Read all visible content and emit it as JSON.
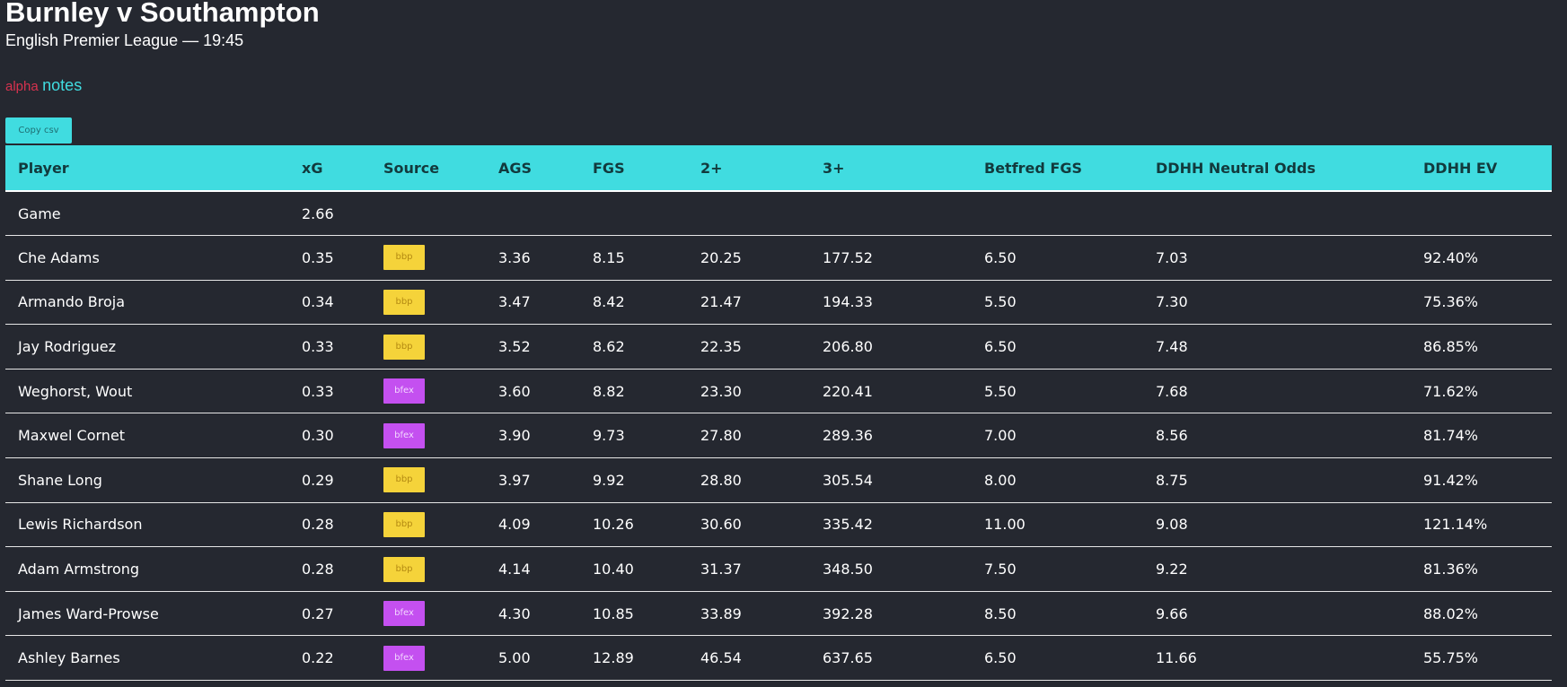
{
  "header": {
    "title": "Burnley v Southampton",
    "subtitle": "English Premier League — 19:45"
  },
  "brand": {
    "alpha": "alpha",
    "notes": "notes"
  },
  "toolbar": {
    "copy_csv_label": "Copy csv"
  },
  "colors": {
    "background": "#252830",
    "accent_cyan": "#40dce0",
    "brand_red": "#d8324f",
    "badge_bbp": "#f5d33a",
    "badge_bfex": "#c450f0"
  },
  "table": {
    "columns": [
      "Player",
      "xG",
      "Source",
      "AGS",
      "FGS",
      "2+",
      "3+",
      "Betfred FGS",
      "DDHH Neutral Odds",
      "DDHH EV"
    ],
    "rows": [
      {
        "player": "Game",
        "xg": "2.66",
        "source": "",
        "ags": "",
        "fgs": "",
        "two_plus": "",
        "three_plus": "",
        "betfred_fgs": "",
        "ddhh_odds": "",
        "ddhh_ev": ""
      },
      {
        "player": "Che Adams",
        "xg": "0.35",
        "source": "bbp",
        "ags": "3.36",
        "fgs": "8.15",
        "two_plus": "20.25",
        "three_plus": "177.52",
        "betfred_fgs": "6.50",
        "ddhh_odds": "7.03",
        "ddhh_ev": "92.40%"
      },
      {
        "player": "Armando Broja",
        "xg": "0.34",
        "source": "bbp",
        "ags": "3.47",
        "fgs": "8.42",
        "two_plus": "21.47",
        "three_plus": "194.33",
        "betfred_fgs": "5.50",
        "ddhh_odds": "7.30",
        "ddhh_ev": "75.36%"
      },
      {
        "player": "Jay Rodriguez",
        "xg": "0.33",
        "source": "bbp",
        "ags": "3.52",
        "fgs": "8.62",
        "two_plus": "22.35",
        "three_plus": "206.80",
        "betfred_fgs": "6.50",
        "ddhh_odds": "7.48",
        "ddhh_ev": "86.85%"
      },
      {
        "player": "Weghorst, Wout",
        "xg": "0.33",
        "source": "bfex",
        "ags": "3.60",
        "fgs": "8.82",
        "two_plus": "23.30",
        "three_plus": "220.41",
        "betfred_fgs": "5.50",
        "ddhh_odds": "7.68",
        "ddhh_ev": "71.62%"
      },
      {
        "player": "Maxwel Cornet",
        "xg": "0.30",
        "source": "bfex",
        "ags": "3.90",
        "fgs": "9.73",
        "two_plus": "27.80",
        "three_plus": "289.36",
        "betfred_fgs": "7.00",
        "ddhh_odds": "8.56",
        "ddhh_ev": "81.74%"
      },
      {
        "player": "Shane Long",
        "xg": "0.29",
        "source": "bbp",
        "ags": "3.97",
        "fgs": "9.92",
        "two_plus": "28.80",
        "three_plus": "305.54",
        "betfred_fgs": "8.00",
        "ddhh_odds": "8.75",
        "ddhh_ev": "91.42%"
      },
      {
        "player": "Lewis Richardson",
        "xg": "0.28",
        "source": "bbp",
        "ags": "4.09",
        "fgs": "10.26",
        "two_plus": "30.60",
        "three_plus": "335.42",
        "betfred_fgs": "11.00",
        "ddhh_odds": "9.08",
        "ddhh_ev": "121.14%"
      },
      {
        "player": "Adam Armstrong",
        "xg": "0.28",
        "source": "bbp",
        "ags": "4.14",
        "fgs": "10.40",
        "two_plus": "31.37",
        "three_plus": "348.50",
        "betfred_fgs": "7.50",
        "ddhh_odds": "9.22",
        "ddhh_ev": "81.36%"
      },
      {
        "player": "James Ward-Prowse",
        "xg": "0.27",
        "source": "bfex",
        "ags": "4.30",
        "fgs": "10.85",
        "two_plus": "33.89",
        "three_plus": "392.28",
        "betfred_fgs": "8.50",
        "ddhh_odds": "9.66",
        "ddhh_ev": "88.02%"
      },
      {
        "player": "Ashley Barnes",
        "xg": "0.22",
        "source": "bfex",
        "ags": "5.00",
        "fgs": "12.89",
        "two_plus": "46.54",
        "three_plus": "637.65",
        "betfred_fgs": "6.50",
        "ddhh_odds": "11.66",
        "ddhh_ev": "55.75%"
      }
    ]
  }
}
